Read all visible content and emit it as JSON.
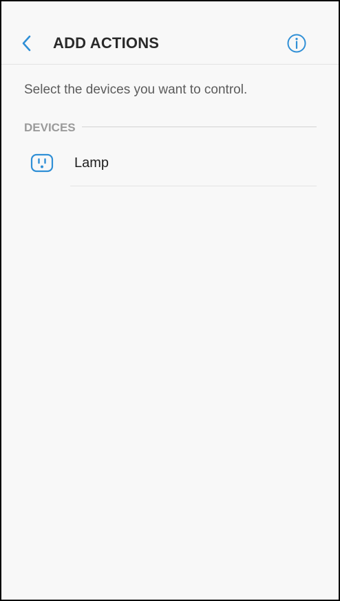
{
  "status_bar": {
    "time": "",
    "indicators": ""
  },
  "header": {
    "title": "ADD ACTIONS",
    "back_icon": "chevron-left-icon",
    "info_icon": "info-icon"
  },
  "main": {
    "instruction": "Select the devices you want to control.",
    "section": {
      "title": "DEVICES"
    },
    "devices": [
      {
        "name": "Lamp",
        "icon": "power-outlet-icon"
      }
    ]
  },
  "colors": {
    "accent": "#2f8fd6",
    "background": "#f8f8f8",
    "title_text": "#2a2a2a",
    "section_text": "#9a9a9a"
  }
}
